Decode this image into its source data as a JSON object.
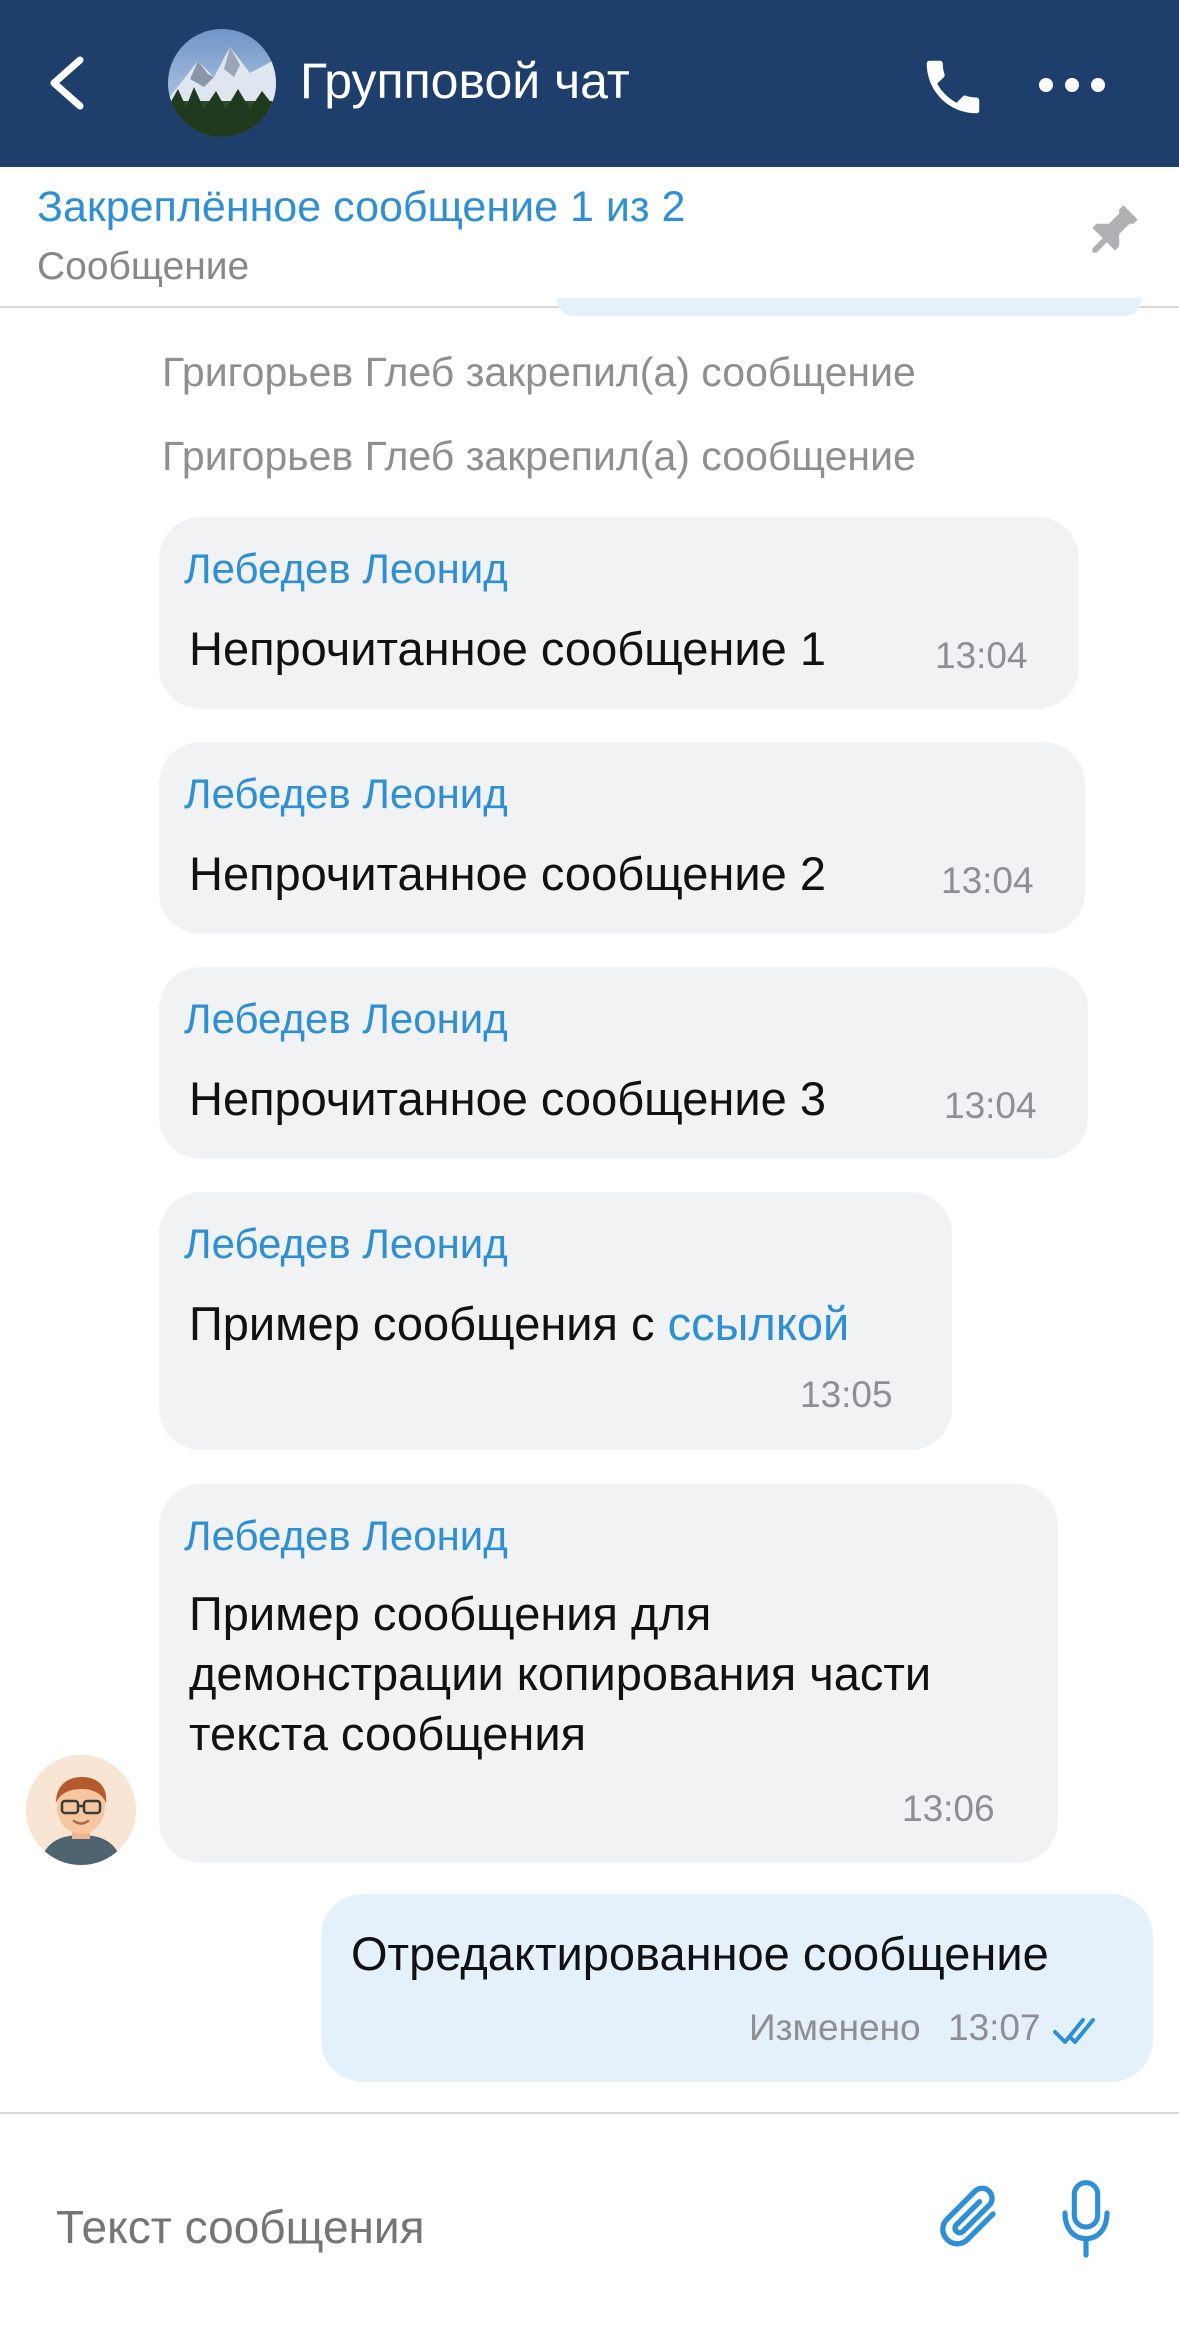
{
  "header": {
    "title": "Групповой чат",
    "icons": {
      "back": "chevron-left-icon",
      "call": "phone-icon",
      "more": "more-horizontal-icon"
    }
  },
  "pinned": {
    "title": "Закреплённое сообщение 1 из 2",
    "subtitle": "Сообщение",
    "icon": "pin-icon"
  },
  "system_messages": [
    "Григорьев Глеб закрепил(а) сообщение",
    "Григорьев Глеб закрепил(а) сообщение"
  ],
  "messages": [
    {
      "author": "Лебедев Леонид",
      "text": "Непрочитанное сообщение 1",
      "time": "13:04"
    },
    {
      "author": "Лебедев Леонид",
      "text": "Непрочитанное сообщение 2",
      "time": "13:04"
    },
    {
      "author": "Лебедев Леонид",
      "text": "Непрочитанное сообщение 3",
      "time": "13:04"
    },
    {
      "author": "Лебедев Леонид",
      "text_prefix": "Пример сообщения с ",
      "link_text": "ссылкой",
      "time": "13:05"
    },
    {
      "author": "Лебедев Леонид",
      "text_lines": [
        "Пример сообщения для",
        "демонстрации копирования части",
        "текста сообщения"
      ],
      "time": "13:06"
    }
  ],
  "own_message": {
    "text": "Отредактированное сообщение",
    "edited_label": "Изменено",
    "time": "13:07",
    "status_icon": "double-check-icon"
  },
  "composer": {
    "placeholder": "Текст сообщения",
    "icons": {
      "attach": "paperclip-icon",
      "mic": "microphone-icon"
    }
  },
  "colors": {
    "header_bg": "#1e3f6b",
    "accent": "#2f8fd4",
    "incoming_bubble": "#f1f2f4",
    "outgoing_bubble": "#e4f1fa"
  }
}
